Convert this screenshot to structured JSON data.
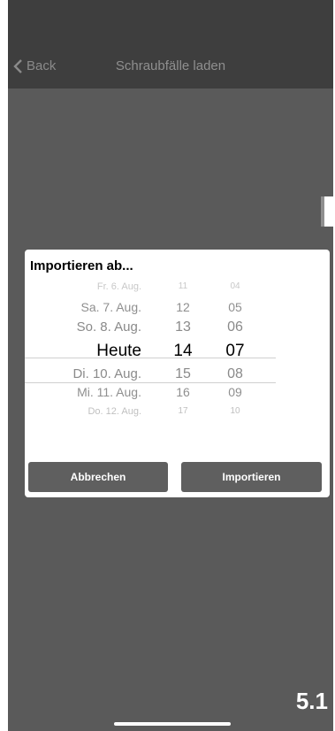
{
  "nav": {
    "back_label": "Back",
    "title": "Schraubfälle laden"
  },
  "dialog": {
    "title": "Importieren ab...",
    "picker": {
      "rows": [
        {
          "day": "Fr. 6. Aug.",
          "hour": "11",
          "minute": "04"
        },
        {
          "day": "Sa. 7. Aug.",
          "hour": "12",
          "minute": "05"
        },
        {
          "day": "So. 8. Aug.",
          "hour": "13",
          "minute": "06"
        },
        {
          "day": "Heute",
          "hour": "14",
          "minute": "07"
        },
        {
          "day": "Di. 10. Aug.",
          "hour": "15",
          "minute": "08"
        },
        {
          "day": "Mi. 11. Aug.",
          "hour": "16",
          "minute": "09"
        },
        {
          "day": "Do. 12. Aug.",
          "hour": "17",
          "minute": "10"
        }
      ],
      "selected_index": 3
    },
    "cancel_label": "Abbrechen",
    "import_label": "Importieren"
  },
  "page_label": "5.1",
  "colors": {
    "background": "#5a5a5a",
    "dialog": "#ffffff",
    "button": "#5f5f5f",
    "text_dim": "#8f8f8f"
  }
}
